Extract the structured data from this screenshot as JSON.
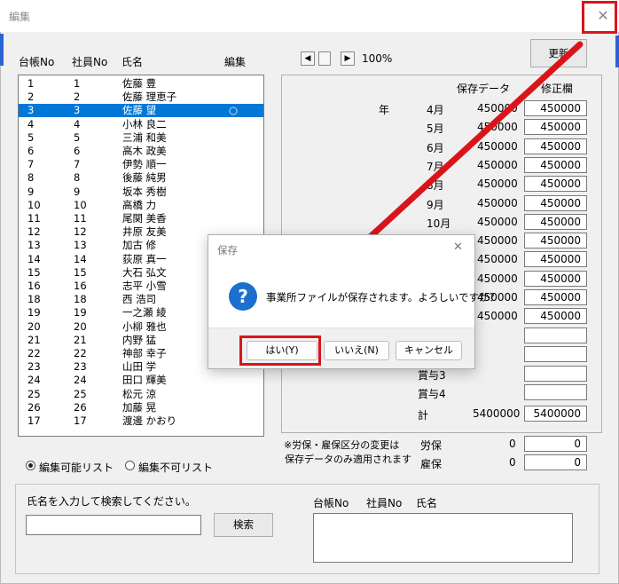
{
  "window": {
    "title": "編集",
    "close_glyph": "✕"
  },
  "list_header": {
    "ledger_no": "台帳No",
    "employee_no": "社員No",
    "name": "氏名",
    "edit": "編集"
  },
  "list_rows": [
    {
      "ledger": "1",
      "emp": "1",
      "name": "佐藤 豊",
      "mark": ""
    },
    {
      "ledger": "2",
      "emp": "2",
      "name": "佐藤 理恵子",
      "mark": ""
    },
    {
      "ledger": "3",
      "emp": "3",
      "name": "佐藤 望",
      "mark": "○"
    },
    {
      "ledger": "4",
      "emp": "4",
      "name": "小林 良二",
      "mark": ""
    },
    {
      "ledger": "5",
      "emp": "5",
      "name": "三浦 和美",
      "mark": ""
    },
    {
      "ledger": "6",
      "emp": "6",
      "name": "高木 政美",
      "mark": ""
    },
    {
      "ledger": "7",
      "emp": "7",
      "name": "伊勢 順一",
      "mark": ""
    },
    {
      "ledger": "8",
      "emp": "8",
      "name": "後藤 純男",
      "mark": ""
    },
    {
      "ledger": "9",
      "emp": "9",
      "name": "坂本 秀樹",
      "mark": ""
    },
    {
      "ledger": "10",
      "emp": "10",
      "name": "高橋 力",
      "mark": ""
    },
    {
      "ledger": "11",
      "emp": "11",
      "name": "尾関 美香",
      "mark": ""
    },
    {
      "ledger": "12",
      "emp": "12",
      "name": "井原 友美",
      "mark": ""
    },
    {
      "ledger": "13",
      "emp": "13",
      "name": "加古 修",
      "mark": ""
    },
    {
      "ledger": "14",
      "emp": "14",
      "name": "荻原 真一",
      "mark": ""
    },
    {
      "ledger": "15",
      "emp": "15",
      "name": "大石 弘文",
      "mark": ""
    },
    {
      "ledger": "16",
      "emp": "16",
      "name": "志平 小雪",
      "mark": ""
    },
    {
      "ledger": "18",
      "emp": "18",
      "name": "西 浩司",
      "mark": ""
    },
    {
      "ledger": "19",
      "emp": "19",
      "name": "一之瀬 綾",
      "mark": ""
    },
    {
      "ledger": "20",
      "emp": "20",
      "name": "小柳 雅也",
      "mark": ""
    },
    {
      "ledger": "21",
      "emp": "21",
      "name": "内野 猛",
      "mark": ""
    },
    {
      "ledger": "22",
      "emp": "22",
      "name": "神部 幸子",
      "mark": ""
    },
    {
      "ledger": "23",
      "emp": "23",
      "name": "山田 学",
      "mark": ""
    },
    {
      "ledger": "24",
      "emp": "24",
      "name": "田口 輝美",
      "mark": ""
    },
    {
      "ledger": "25",
      "emp": "25",
      "name": "松元 涼",
      "mark": ""
    },
    {
      "ledger": "26",
      "emp": "26",
      "name": "加藤 晃",
      "mark": ""
    },
    {
      "ledger": "17",
      "emp": "17",
      "name": "渡邊 かおり",
      "mark": ""
    }
  ],
  "selected_row_index": 2,
  "zoom": {
    "left_arrow": "◀",
    "right_arrow": "▶",
    "value": "100%"
  },
  "update_button": "更新",
  "panel": {
    "saved_header": "保存データ",
    "fix_header": "修正欄",
    "year_label": "年",
    "months": [
      {
        "label": "4月",
        "saved": "450000",
        "fix": "450000"
      },
      {
        "label": "5月",
        "saved": "450000",
        "fix": "450000"
      },
      {
        "label": "6月",
        "saved": "450000",
        "fix": "450000"
      },
      {
        "label": "7月",
        "saved": "450000",
        "fix": "450000"
      },
      {
        "label": "8月",
        "saved": "450000",
        "fix": "450000"
      },
      {
        "label": "9月",
        "saved": "450000",
        "fix": "450000"
      },
      {
        "label": "10月",
        "saved": "450000",
        "fix": "450000"
      },
      {
        "label": "",
        "saved": "450000",
        "fix": "450000"
      },
      {
        "label": "",
        "saved": "450000",
        "fix": "450000"
      },
      {
        "label": "",
        "saved": "450000",
        "fix": "450000"
      },
      {
        "label": "",
        "saved": "450000",
        "fix": "450000"
      },
      {
        "label": "",
        "saved": "450000",
        "fix": "450000"
      }
    ],
    "bonus": [
      {
        "label": "",
        "fix": ""
      },
      {
        "label": "",
        "fix": ""
      },
      {
        "label": "賞与3",
        "fix": ""
      },
      {
        "label": "賞与4",
        "fix": ""
      }
    ],
    "total_label": "計",
    "total_saved": "5400000",
    "total_fix": "5400000",
    "note_line1": "※労保・雇保区分の変更は",
    "note_line2": "保存データのみ適用されます",
    "roho_label": "労保",
    "roho_saved": "0",
    "roho_fix": "0",
    "koho_label": "雇保",
    "koho_saved": "0",
    "koho_fix": "0"
  },
  "radios": {
    "editable": "編集可能リスト",
    "not_editable": "編集不可リスト",
    "selected": "editable"
  },
  "search": {
    "prompt": "氏名を入力して検索してください。",
    "value": "",
    "button": "検索",
    "result_ledger": "台帳No",
    "result_emp": "社員No",
    "result_name": "氏名"
  },
  "dialog": {
    "title": "保存",
    "close_glyph": "✕",
    "icon_glyph": "?",
    "message": "事業所ファイルが保存されます。よろしいですか？",
    "yes": "はい(Y)",
    "no": "いいえ(N)",
    "cancel": "キャンセル"
  },
  "colors": {
    "highlight_red": "#d9151b",
    "selection_blue": "#0078d7",
    "info_blue": "#1c6fce"
  }
}
